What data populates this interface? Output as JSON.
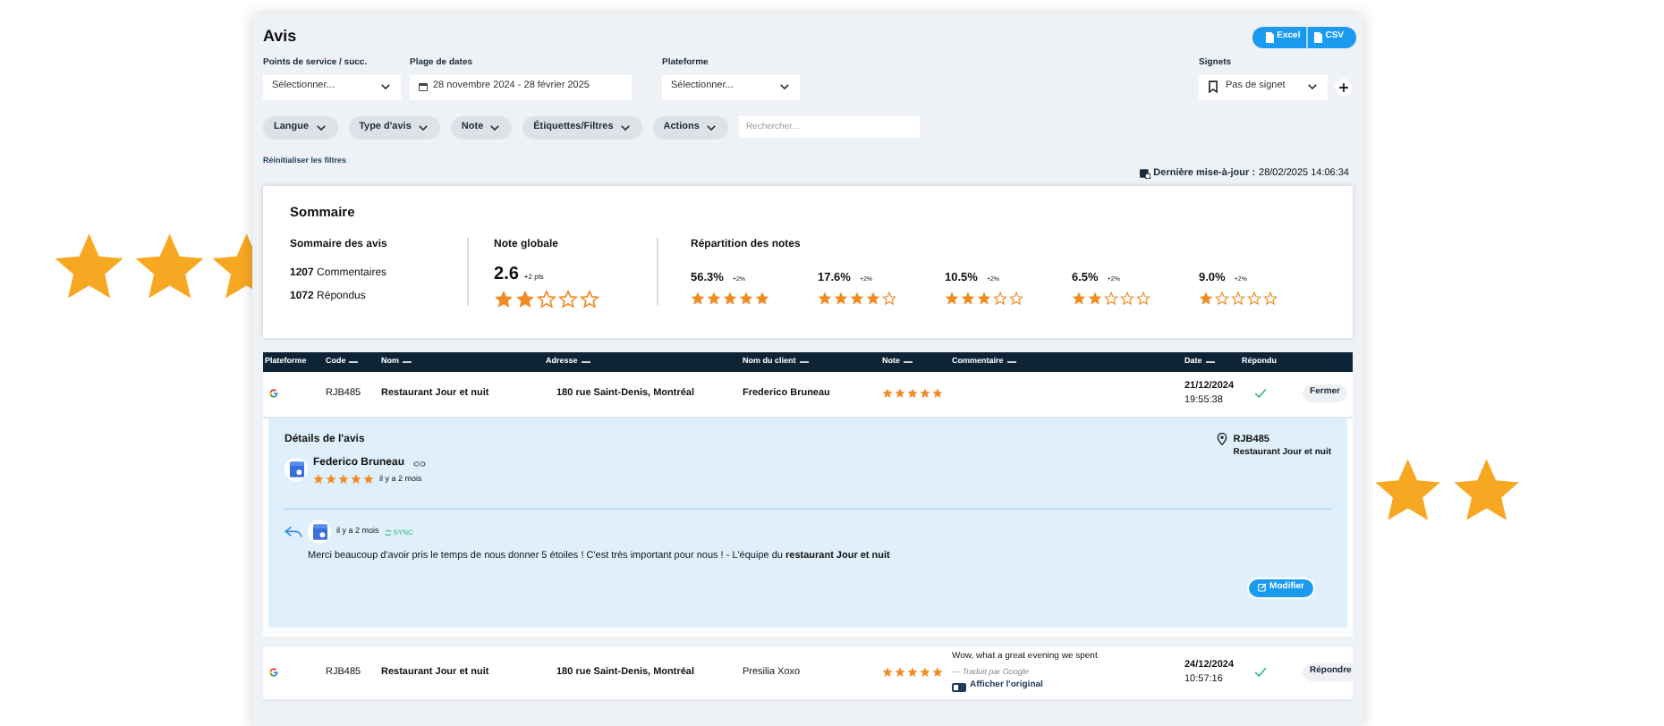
{
  "title": "Avis",
  "export_buttons": [
    "Excel",
    "CSV"
  ],
  "filters": [
    {
      "kind": "select",
      "label": "Points de service / succ.",
      "value": "Sélectionner..."
    },
    {
      "kind": "date",
      "label": "Plage de dates",
      "value": "28 novembre 2024 - 28 février 2025"
    },
    {
      "kind": "select",
      "label": "Plateforme",
      "value": "Sélectionner..."
    }
  ],
  "bookmarks": {
    "label": "Signets",
    "value": "Pas de signet"
  },
  "chips": [
    "Langue",
    "Type d'avis",
    "Note",
    "Étiquettes/Filtres",
    "Actions"
  ],
  "search": {
    "placeholder": "Rechercher..."
  },
  "reset_link": "Réinitialiser les filtres",
  "last_update": {
    "label": "Dernière mise-à-jour :",
    "value": "28/02/2025 14:06:34"
  },
  "summary": {
    "title": "Sommaire",
    "reviews": {
      "title": "Sommaire des avis",
      "lines": [
        {
          "count": "1207",
          "label": "Commentaires"
        },
        {
          "count": "1072",
          "label": "Répondus"
        }
      ]
    },
    "global": {
      "title": "Note globale",
      "score": "2.6",
      "delta": "+2 pts",
      "stars": 2
    },
    "distribution": {
      "title": "Répartition des notes",
      "items": [
        {
          "percent": "56.3%",
          "delta": "+2%",
          "stars": 5
        },
        {
          "percent": "17.6%",
          "delta": "+2%",
          "stars": 4
        },
        {
          "percent": "10.5%",
          "delta": "+2%",
          "stars": 3
        },
        {
          "percent": "6.5%",
          "delta": "+2%",
          "stars": 2
        },
        {
          "percent": "9.0%",
          "delta": "+2%",
          "stars": 1
        }
      ]
    }
  },
  "table": {
    "columns": [
      {
        "label": "Plateforme",
        "sortable": false
      },
      {
        "label": "Code",
        "sortable": true
      },
      {
        "label": "Nom",
        "sortable": true
      },
      {
        "label": "Adresse",
        "sortable": true
      },
      {
        "label": "Nom du client",
        "sortable": true
      },
      {
        "label": "Note",
        "sortable": true
      },
      {
        "label": "Commentaire",
        "sortable": true
      },
      {
        "label": "Date",
        "sortable": true
      },
      {
        "label": "Répondu",
        "sortable": false
      }
    ],
    "rows": [
      {
        "code": "RJB485",
        "name": "Restaurant Jour et nuit",
        "address": "180 rue Saint-Denis, Montréal",
        "client": "Frederico Bruneau",
        "stars": 5,
        "date": "21/12/2024",
        "time": "19:55:38",
        "answered": true,
        "action": "Fermer",
        "details": {
          "title": "Détails de l'avis",
          "reviewer": "Federico Bruneau",
          "stars": 5,
          "ago": "il y a 2 mois",
          "location_code": "RJB485",
          "location_name": "Restaurant Jour et nuit",
          "reply": {
            "ago": "il y a 2 mois",
            "sync": "SYNC",
            "text": "Merci beaucoup d'avoir pris le temps de nous donner 5 étoiles ! C'est très important pour nous ! - L'équipe du **restaurant Jour et nuit**",
            "button": "Modifier"
          }
        }
      },
      {
        "code": "RJB485",
        "name": "Restaurant Jour et nuit",
        "address": "180 rue Saint-Denis, Montréal",
        "client": "Presilia Xoxo",
        "stars": 5,
        "comment": "Wow, what a great evening we spent",
        "translated": "— Traduit par Google",
        "original_link": "Afficher l'original",
        "date": "24/12/2024",
        "time": "10:57:16",
        "answered": true,
        "action": "Répondre"
      }
    ]
  }
}
